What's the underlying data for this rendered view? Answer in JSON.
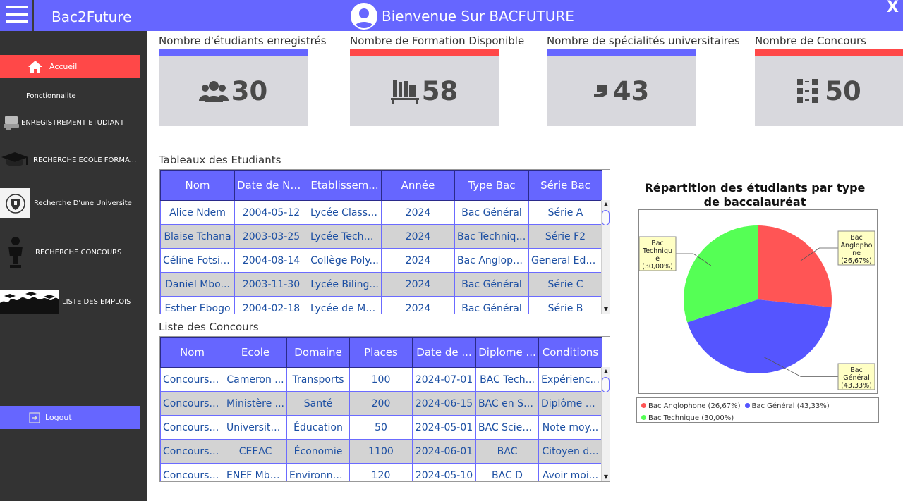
{
  "header": {
    "app_name": "Bac2Future",
    "welcome": "Bienvenue Sur BACFUTURE",
    "close": "X"
  },
  "sidebar": {
    "accueil": "Accueil",
    "section": "Fonctionnalite",
    "items": [
      {
        "label": "ENREGISTREMENT ETUDIANT"
      },
      {
        "label": "RECHERCHE ECOLE FORMA..."
      },
      {
        "label": "Recherche D'une Universite"
      },
      {
        "label": "RECHERCHE CONCOURS"
      },
      {
        "label": "LISTE DES EMPLOIS"
      }
    ],
    "logout": "Logout"
  },
  "stats": [
    {
      "title": "Nombre d'étudiants enregistrés",
      "value": "30",
      "bar_color": "#6666ff",
      "icon": "users-icon"
    },
    {
      "title": "Nombre de Formation Disponible",
      "value": "58",
      "bar_color": "#ff4848",
      "icon": "books-icon"
    },
    {
      "title": "Nombre de spécialités universitaires",
      "value": "43",
      "bar_color": "#6666ff",
      "icon": "hand-book-icon"
    },
    {
      "title": "Nombre de Concours",
      "value": "50",
      "bar_color": "#ff4848",
      "icon": "checklist-icon"
    }
  ],
  "students": {
    "title": "Tableaux des Etudiants",
    "columns": [
      "Nom",
      "Date de Na...",
      "Etablissem...",
      "Année",
      "Type Bac",
      "Série Bac"
    ],
    "rows": [
      [
        "Alice Ndem",
        "2004-05-12",
        "Lycée Classi...",
        "2024",
        "Bac Général",
        "Série A"
      ],
      [
        "Blaise Tchana",
        "2003-03-25",
        "Lycée Techn...",
        "2024",
        "Bac Technique",
        "Série F2"
      ],
      [
        "Céline Fotsing",
        "2004-08-14",
        "Collège Poly...",
        "2024",
        "Bac Angloph...",
        "General Edu..."
      ],
      [
        "Daniel Mbo...",
        "2003-11-30",
        "Lycée Biling...",
        "2024",
        "Bac Général",
        "Série C"
      ],
      [
        "Esther Ebogo",
        "2004-02-18",
        "Lycée de Ma...",
        "2024",
        "Bac Général",
        "Série B"
      ]
    ]
  },
  "concours": {
    "title": "Liste des Concours",
    "columns": [
      "Nom",
      "Ecole",
      "Domaine",
      "Places",
      "Date de ...",
      "Diplome ...",
      "Conditions"
    ],
    "rows": [
      [
        "Concours ...",
        "Cameron ...",
        "Transports",
        "100",
        "2024-07-01",
        "BAC Tech...",
        "Expérienc..."
      ],
      [
        "Concours I...",
        "Ministère ...",
        "Santé",
        "200",
        "2024-06-15",
        "BAC en Sci...",
        "Diplôme d..."
      ],
      [
        "Concours ...",
        "Université ...",
        "Éducation",
        "50",
        "2024-05-01",
        "BAC Scien...",
        "Note moy..."
      ],
      [
        "Concours ...",
        "CEEAC",
        "Économie",
        "1100",
        "2024-06-01",
        "BAC",
        "Citoyen d..."
      ],
      [
        "Concours ...",
        "ENEF Mba...",
        "Environne...",
        "120",
        "2024-05-10",
        "BAC D",
        "Avoir moi..."
      ]
    ]
  },
  "chart_data": {
    "type": "pie",
    "title": "Répartition des étudiants par type de baccalauréat",
    "slices": [
      {
        "name": "Bac Anglophone",
        "value": 26.67,
        "label": "Bac Anglophone (26,67%)",
        "color": "#ff5555"
      },
      {
        "name": "Bac Général",
        "value": 43.33,
        "label": "Bac Général (43,33%)",
        "color": "#5555ff"
      },
      {
        "name": "Bac Technique",
        "value": 30.0,
        "label": "Bac Technique (30,00%)",
        "color": "#55ff55"
      }
    ],
    "callouts": [
      {
        "lines": [
          "Bac",
          "Anglopho",
          "ne",
          "(26,67%)"
        ]
      },
      {
        "lines": [
          "Bac",
          "Général",
          "(43,33%)"
        ]
      },
      {
        "lines": [
          "Bac",
          "Techniqu",
          "e",
          "(30,00%)"
        ]
      }
    ],
    "legend_placement": "bottom"
  }
}
